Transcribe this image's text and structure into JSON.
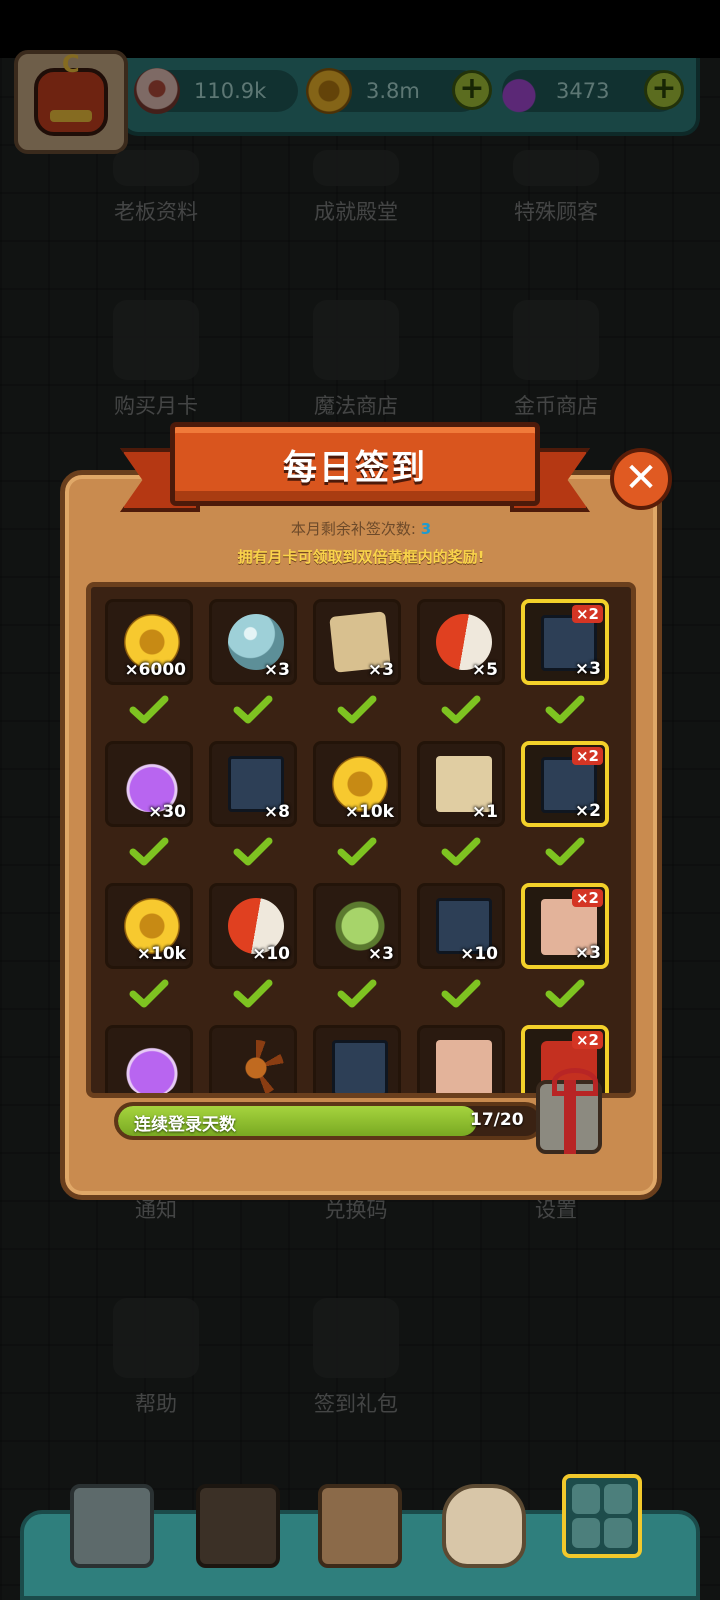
{
  "resources": {
    "eyes": "110.9k",
    "coins": "3.8m",
    "potions": "3473",
    "eye_icon": "eyeball-icon",
    "coin_icon": "gold-coin-icon",
    "potion_icon": "purple-potion-icon"
  },
  "menu": {
    "boss_profile": "老板资料",
    "hall_of_fame": "成就殿堂",
    "special_customers": "特殊顾客",
    "buy_monthly_card": "购买月卡",
    "magic_shop": "魔法商店",
    "coin_shop": "金币商店",
    "notifications": "通知",
    "redeem_code": "兑换码",
    "settings": "设置",
    "help": "帮助",
    "signin_pack": "签到礼包"
  },
  "dialog": {
    "title": "每日签到",
    "remaining_label": "本月剩余补签次数:",
    "remaining_count": "3",
    "monthly_card_hint": "拥有月卡可领取到双倍黄框内的奖励!",
    "progress_label": "连续登录天数",
    "progress_count": "17/20",
    "progress_value": 0.85,
    "double_badge": "×2"
  },
  "rewards": [
    {
      "item": "gold-coin",
      "qty": "×6000",
      "claimed": true,
      "double": false
    },
    {
      "item": "crystal-orb",
      "qty": "×3",
      "claimed": true,
      "double": false
    },
    {
      "item": "treasure-map",
      "qty": "×3",
      "claimed": true,
      "double": false
    },
    {
      "item": "capsule",
      "qty": "×5",
      "claimed": true,
      "double": false
    },
    {
      "item": "monster-card",
      "qty": "×3",
      "claimed": true,
      "double": true
    },
    {
      "item": "purple-potion",
      "qty": "×30",
      "claimed": true,
      "double": false
    },
    {
      "item": "monster-ticket",
      "qty": "×8",
      "claimed": true,
      "double": false
    },
    {
      "item": "gold-coin",
      "qty": "×10k",
      "claimed": true,
      "double": false
    },
    {
      "item": "ticket",
      "qty": "×1",
      "claimed": true,
      "double": false
    },
    {
      "item": "monster-card",
      "qty": "×2",
      "claimed": true,
      "double": true
    },
    {
      "item": "gold-coin",
      "qty": "×10k",
      "claimed": true,
      "double": false
    },
    {
      "item": "capsule",
      "qty": "×10",
      "claimed": true,
      "double": false
    },
    {
      "item": "skull-bottle",
      "qty": "×3",
      "claimed": true,
      "double": false
    },
    {
      "item": "monster-ticket",
      "qty": "×10",
      "claimed": true,
      "double": false
    },
    {
      "item": "scroll",
      "qty": "×3",
      "claimed": true,
      "double": true
    },
    {
      "item": "purple-potion",
      "qty": "",
      "claimed": false,
      "double": false
    },
    {
      "item": "leaves",
      "qty": "",
      "claimed": false,
      "double": false
    },
    {
      "item": "monster-card",
      "qty": "",
      "claimed": false,
      "double": false
    },
    {
      "item": "scroll",
      "qty": "",
      "claimed": false,
      "double": false
    },
    {
      "item": "lantern",
      "qty": "",
      "claimed": false,
      "double": true
    }
  ],
  "colors": {
    "accent_gold": "#f3d12a",
    "banner_red": "#d9551e",
    "check_green": "#7ec321",
    "progress_green": "#a6d43e"
  }
}
